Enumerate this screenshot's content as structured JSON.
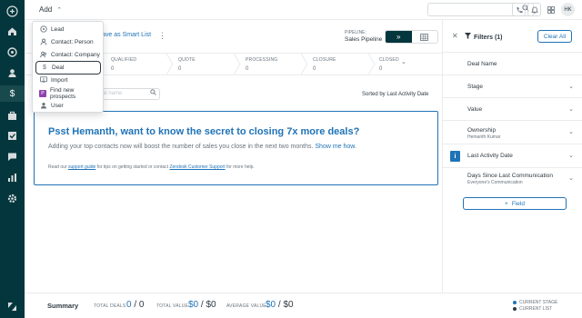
{
  "topbar": {
    "add_label": "Add",
    "avatar_initials": "HK"
  },
  "nav": {
    "items": [
      "home",
      "leads",
      "contacts",
      "deals",
      "briefcase",
      "tasks",
      "messages",
      "reports",
      "settings"
    ],
    "active": "deals"
  },
  "add_menu": {
    "items": [
      {
        "label": "Lead",
        "icon": "lead-icon"
      },
      {
        "label": "Contact: Person",
        "icon": "person-icon"
      },
      {
        "label": "Contact: Company",
        "icon": "company-icon"
      },
      {
        "label": "Deal",
        "icon": "dollar-icon",
        "selected": true
      },
      {
        "label": "Import",
        "icon": "import-icon"
      },
      {
        "label": "Find new prospects",
        "icon": "prospects-icon"
      },
      {
        "label": "User",
        "icon": "user-icon"
      }
    ]
  },
  "toolbar": {
    "smart_list_label": "ave as Smart List",
    "pipeline_label": "PIPELINE:",
    "pipeline_value": "Sales Pipeline"
  },
  "stages": [
    {
      "name": "QUALIFIED",
      "count": "0"
    },
    {
      "name": "QUOTE",
      "count": "0"
    },
    {
      "name": "PROCESSING",
      "count": "0"
    },
    {
      "name": "CLOSURE",
      "count": "0"
    },
    {
      "name": "CLOSED",
      "count": "0"
    }
  ],
  "list": {
    "search_placeholder": "al name",
    "sorted_by": "Sorted by Last Activity Date"
  },
  "promo": {
    "heading": "Psst Hemanth, want to know the secret to closing 7x more deals?",
    "body": "Adding your top contacts now will boost the number of sales you close in the next two months. ",
    "body_link": "Show me how.",
    "foot_1": "Read our ",
    "foot_link_1": "support guide",
    "foot_2": " for tips on getting started or contact ",
    "foot_link_2": "Zendesk Customer Support",
    "foot_3": " for more help."
  },
  "filters": {
    "title": "Filters (1)",
    "clear_label": "Clear All",
    "rows": [
      {
        "label": "Deal Name",
        "sub": ""
      },
      {
        "label": "Stage",
        "sub": ""
      },
      {
        "label": "Value",
        "sub": ""
      },
      {
        "label": "Ownership",
        "sub": "Hemanth Kumar"
      },
      {
        "label": "Last Activity Date",
        "sub": ""
      },
      {
        "label": "Days Since Last Communication",
        "sub": "Everyone's Communication"
      }
    ],
    "add_field_label": "Field"
  },
  "summary": {
    "title": "Summary",
    "total_deals_label": "TOTAL DEALS",
    "total_deals_current": "0",
    "total_deals_list": "0",
    "total_value_label": "TOTAL VALUE",
    "total_value_current": "$0",
    "total_value_list": "$0",
    "average_value_label": "AVERAGE VALUE",
    "average_value_current": "$0",
    "average_value_list": "$0",
    "legend_current": "CURRENT STAGE",
    "legend_list": "CURRENT LIST"
  },
  "colors": {
    "nav_bg": "#03363d",
    "accent": "#1f73b7",
    "text": "#2f3941",
    "muted": "#68737d"
  }
}
